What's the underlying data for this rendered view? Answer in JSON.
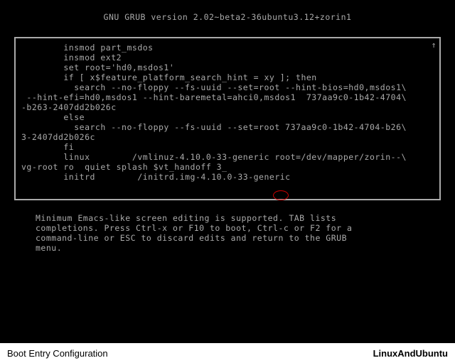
{
  "header": {
    "title": "GNU GRUB  version 2.02~beta2-36ubuntu3.12+zorin1"
  },
  "config": {
    "lines": "        insmod part_msdos\n        insmod ext2\n        set root='hd0,msdos1'\n        if [ x$feature_platform_search_hint = xy ]; then\n          search --no-floppy --fs-uuid --set=root --hint-bios=hd0,msdos1\\\n --hint-efi=hd0,msdos1 --hint-baremetal=ahci0,msdos1  737aa9c0-1b42-4704\\\n-b263-2407dd2b026c\n        else\n          search --no-floppy --fs-uuid --set=root 737aa9c0-1b42-4704-b26\\\n3-2407dd2b026c\n        fi\n        linux        /vmlinuz-4.10.0-33-generic root=/dev/mapper/zorin--\\\nvg-root ro  quiet splash $vt_handoff 3_\n        initrd        /initrd.img-4.10.0-33-generic\n\n",
    "scroll_up": "↑"
  },
  "help": {
    "text": "Minimum Emacs-like screen editing is supported. TAB lists\ncompletions. Press Ctrl-x or F10 to boot, Ctrl-c or F2 for a\ncommand-line or ESC to discard edits and return to the GRUB\nmenu."
  },
  "footer": {
    "left": "Boot Entry Configuration",
    "right": "LinuxAndUbuntu"
  }
}
